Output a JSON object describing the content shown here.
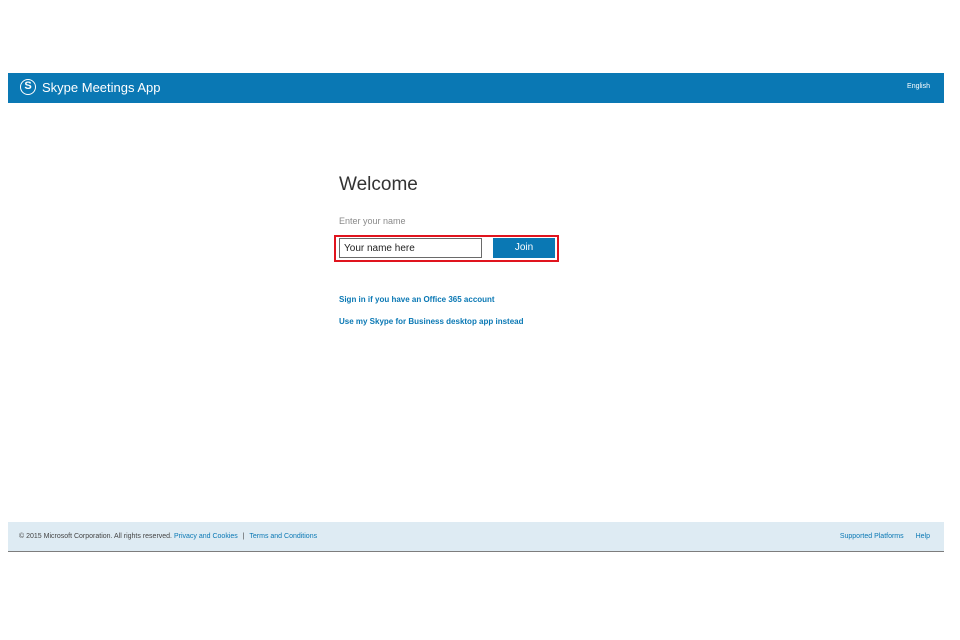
{
  "header": {
    "logo_glyph": "S",
    "app_title": "Skype Meetings App",
    "language": "English",
    "background_color": "#0a78b4"
  },
  "main": {
    "welcome": "Welcome",
    "name_label": "Enter your name",
    "name_input_value": "Your name here",
    "join_label": "Join",
    "highlight_color": "#e0141e",
    "links": {
      "office365": "Sign in if you have an Office 365 account",
      "desktop_app": "Use my Skype for Business desktop app instead"
    }
  },
  "footer": {
    "copyright": "© 2015 Microsoft Corporation. All rights reserved.",
    "privacy": "Privacy and Cookies",
    "separator": "|",
    "terms": "Terms and Conditions",
    "supported_platforms": "Supported Platforms",
    "help": "Help"
  }
}
